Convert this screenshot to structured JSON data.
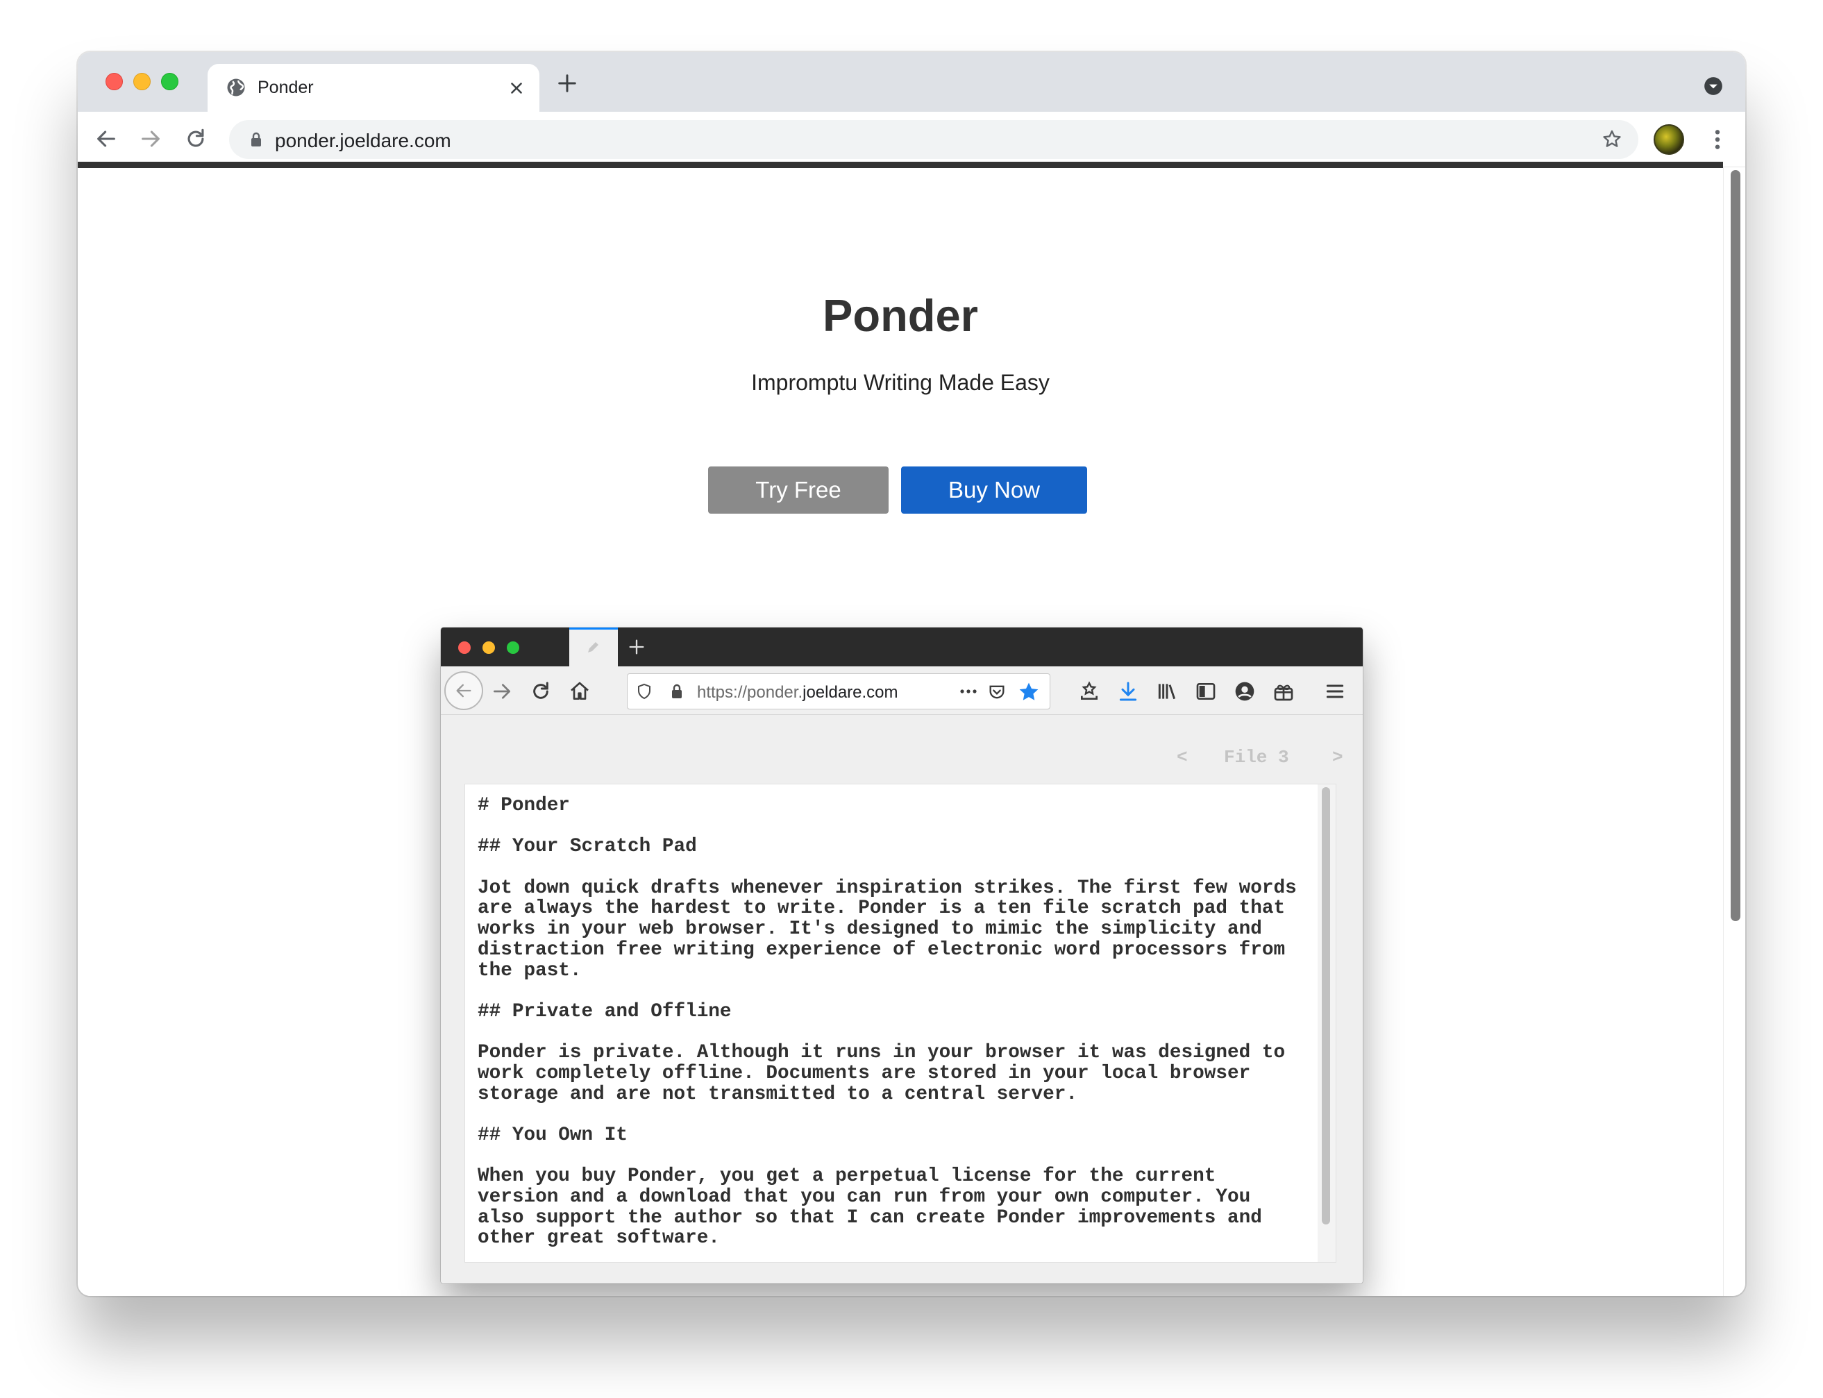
{
  "browser": {
    "tab_title": "Ponder",
    "url": "ponder.joeldare.com"
  },
  "page": {
    "title": "Ponder",
    "subtitle": "Impromptu Writing Made Easy",
    "buttons": {
      "try_free": "Try Free",
      "buy_now": "Buy Now"
    }
  },
  "preview": {
    "url_prefix": "https://ponder.",
    "url_domain": "joeldare.com",
    "file_nav": {
      "prev": "<",
      "label": "File 3",
      "next": ">"
    },
    "lines": [
      "# Ponder",
      "",
      "## Your Scratch Pad",
      "",
      "Jot down quick drafts whenever inspiration strikes. The first few words",
      "are always the hardest to write. Ponder is a ten file scratch pad that",
      "works in your web browser. It's designed to mimic the simplicity and",
      "distraction free writing experience of electronic word processors from",
      "the past.",
      "",
      "## Private and Offline",
      "",
      "Ponder is private. Although it runs in your browser it was designed to",
      "work completely offline. Documents are stored in your local browser",
      "storage and are not transmitted to a central server.",
      "",
      "## You Own It",
      "",
      "When you buy Ponder, you get a perpetual license for the current",
      "version and a download that you can run from your own computer. You",
      "also support the author so that I can create Ponder improvements and",
      "other great software."
    ]
  },
  "colors": {
    "buy_button": "#1663c7",
    "try_button": "#8a8a8a",
    "title_text": "#333333"
  }
}
